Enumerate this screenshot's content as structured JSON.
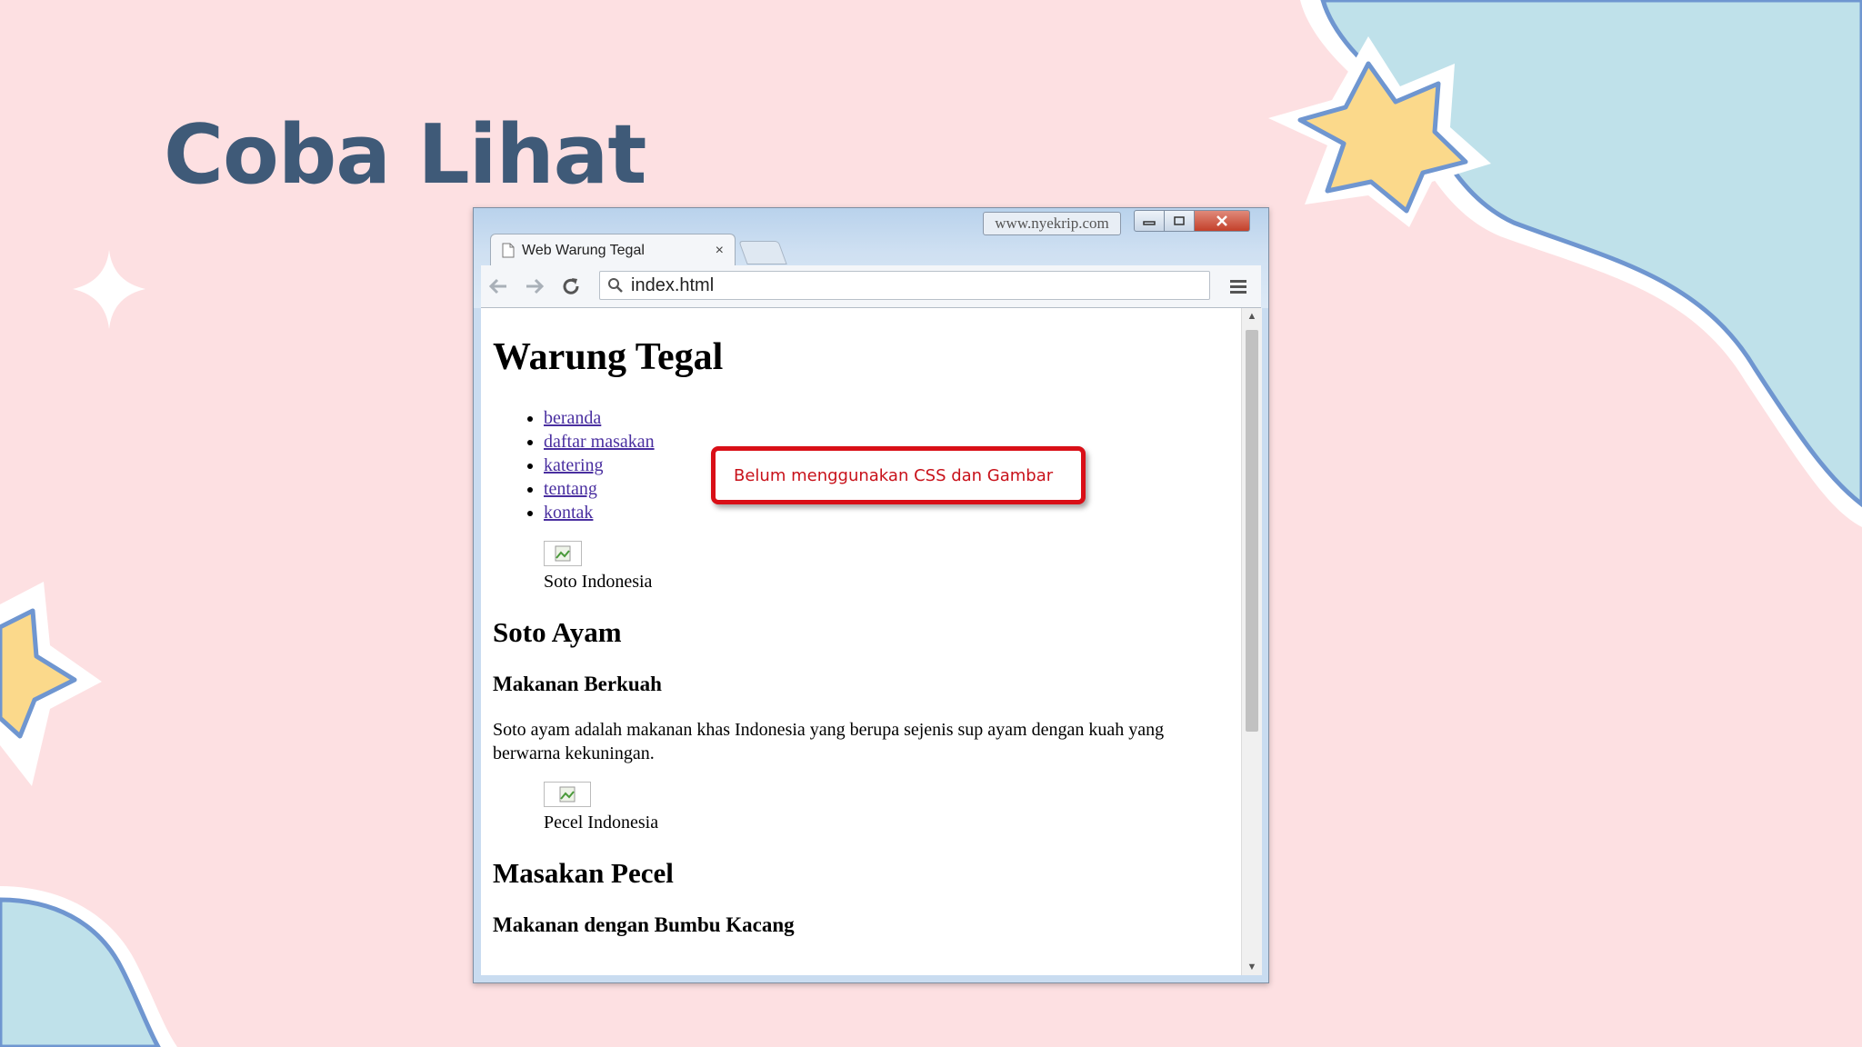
{
  "slide": {
    "title": "Coba Lihat",
    "callout": "Belum menggunakan CSS dan Gambar"
  },
  "browser": {
    "watermark": "www.nyekrip.com",
    "tab_title": "Web Warung Tegal",
    "tab_close": "×",
    "address": "index.html",
    "icons": [
      "back-arrow-icon",
      "forward-arrow-icon",
      "reload-icon",
      "search-icon",
      "menu-icon",
      "page-icon"
    ]
  },
  "page": {
    "heading": "Warung Tegal",
    "nav": [
      "beranda",
      "daftar masakan",
      "katering",
      "tentang",
      "kontak"
    ],
    "figure1_caption": "Soto Indonesia",
    "section1_title": "Soto Ayam",
    "section1_subtitle": "Makanan Berkuah",
    "section1_text": "Soto ayam adalah makanan khas Indonesia yang berupa sejenis sup ayam dengan kuah yang berwarna kekuningan.",
    "figure2_caption": "Pecel Indonesia",
    "section2_title": "Masakan Pecel",
    "section2_subtitle": "Makanan dengan Bumbu Kacang"
  },
  "colors": {
    "background": "#fde0e2",
    "blob": "#bfe1ea",
    "blob_outline": "#6f96d0",
    "star": "#fbd98b",
    "title": "#3f5a78",
    "callout_border": "#d90f17",
    "link": "#4a2fa0"
  }
}
